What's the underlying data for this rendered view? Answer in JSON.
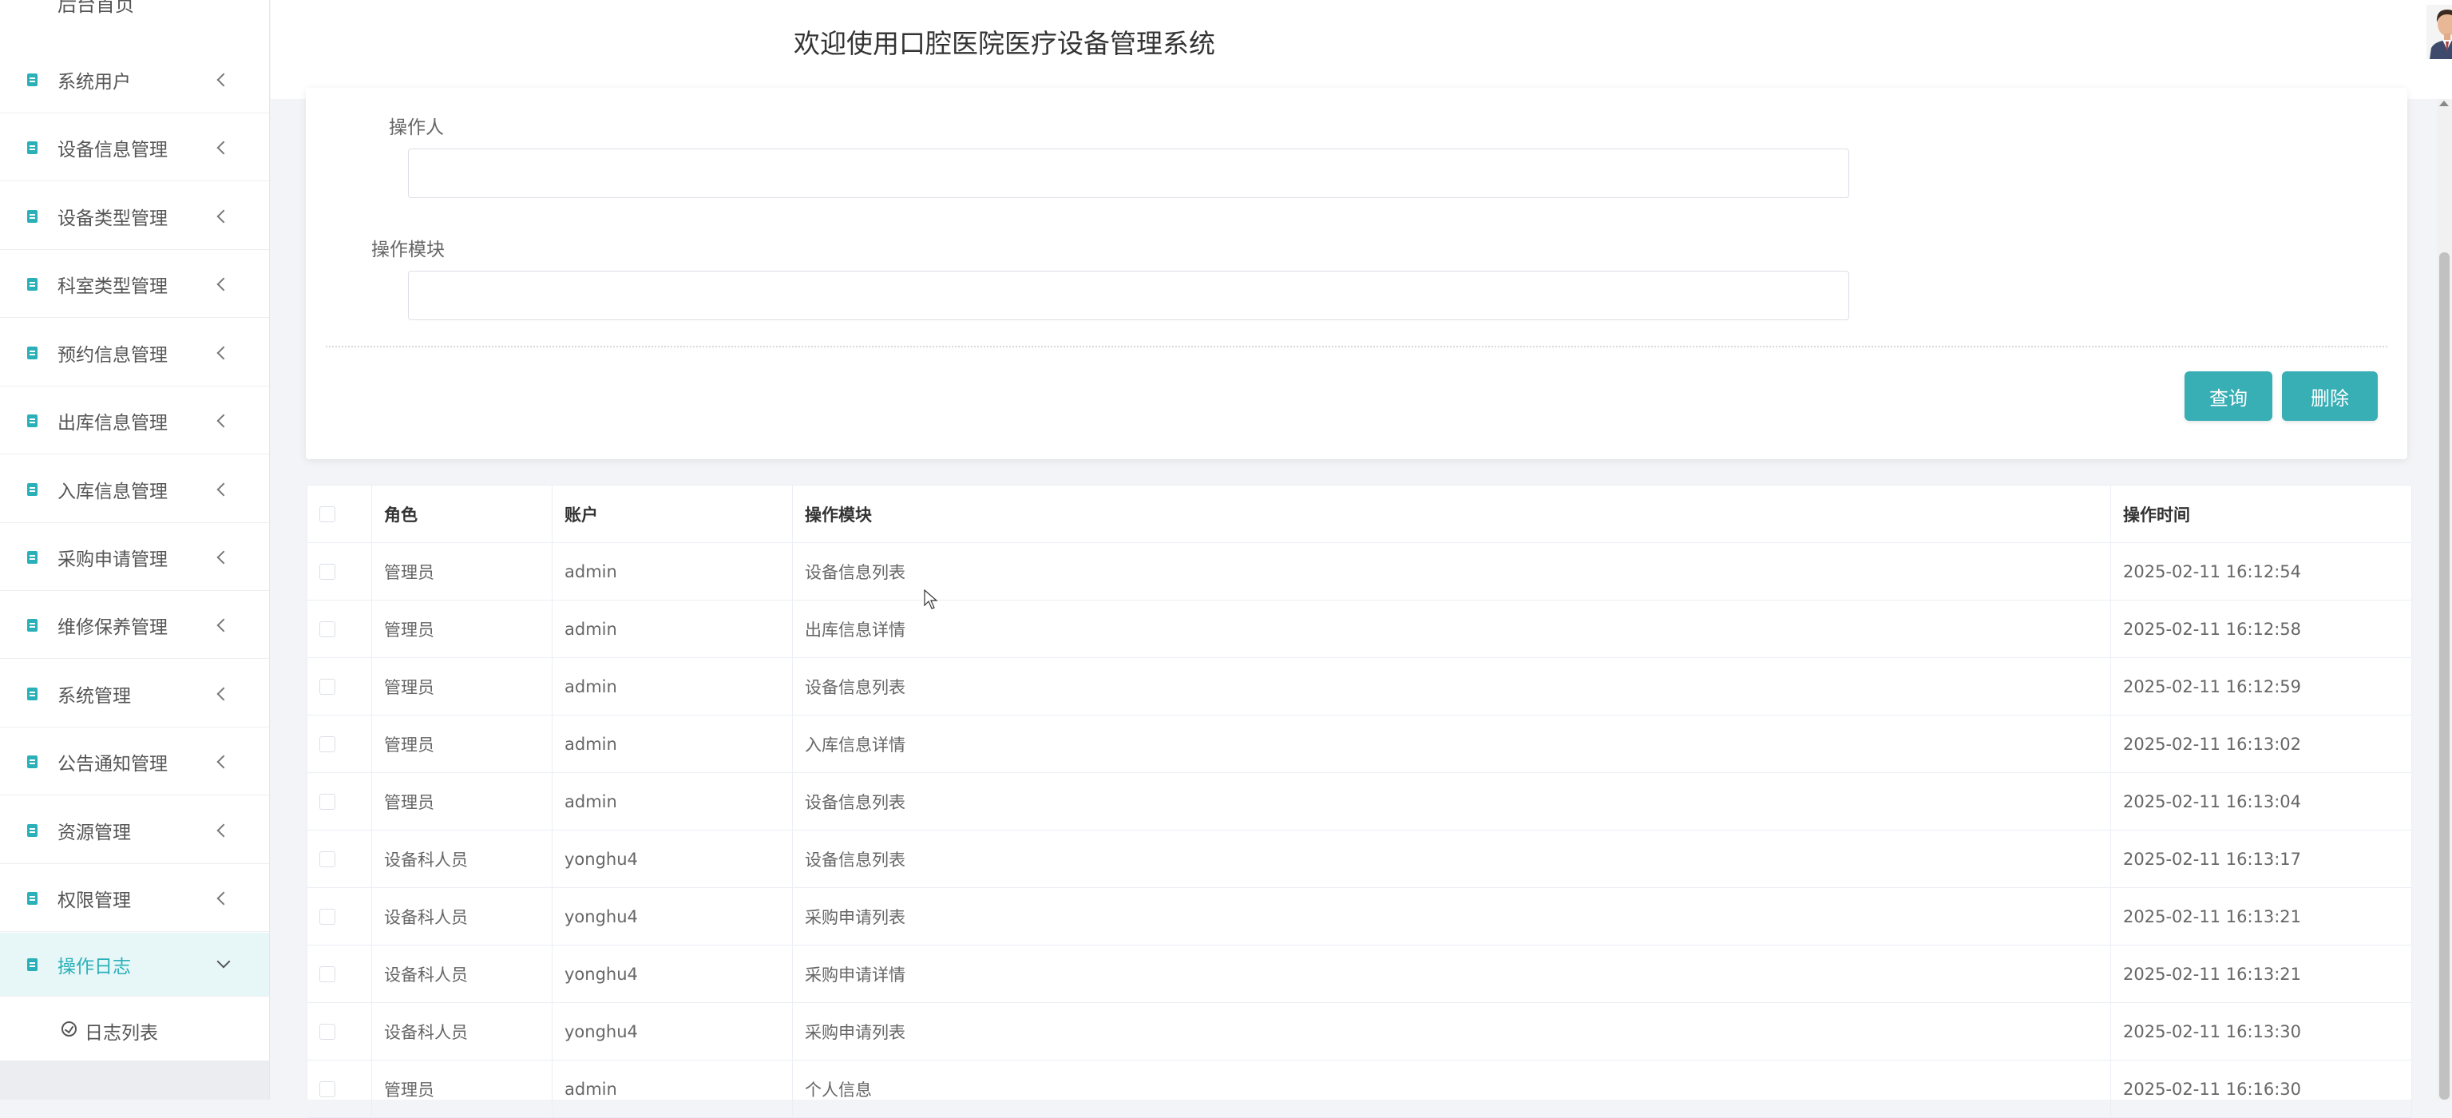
{
  "sidebar": {
    "partial_label": "后台首页",
    "items": [
      {
        "label": "系统用户"
      },
      {
        "label": "设备信息管理"
      },
      {
        "label": "设备类型管理"
      },
      {
        "label": "科室类型管理"
      },
      {
        "label": "预约信息管理"
      },
      {
        "label": "出库信息管理"
      },
      {
        "label": "入库信息管理"
      },
      {
        "label": "采购申请管理"
      },
      {
        "label": "维修保养管理"
      },
      {
        "label": "系统管理"
      },
      {
        "label": "公告通知管理"
      },
      {
        "label": "资源管理"
      },
      {
        "label": "权限管理"
      },
      {
        "label": "操作日志"
      }
    ],
    "active_item": "操作日志",
    "submenu": {
      "label": "日志列表"
    }
  },
  "header": {
    "title": "欢迎使用口腔医院医疗设备管理系统"
  },
  "search": {
    "operator_label": "操作人",
    "operator_value": "",
    "module_label": "操作模块",
    "module_value": "",
    "query_button": "查询",
    "delete_button": "删除"
  },
  "table": {
    "columns": [
      "角色",
      "账户",
      "操作模块",
      "操作时间"
    ],
    "rows": [
      {
        "role": "管理员",
        "account": "admin",
        "module": "设备信息列表",
        "time": "2025-02-11 16:12:54"
      },
      {
        "role": "管理员",
        "account": "admin",
        "module": "出库信息详情",
        "time": "2025-02-11 16:12:58"
      },
      {
        "role": "管理员",
        "account": "admin",
        "module": "设备信息列表",
        "time": "2025-02-11 16:12:59"
      },
      {
        "role": "管理员",
        "account": "admin",
        "module": "入库信息详情",
        "time": "2025-02-11 16:13:02"
      },
      {
        "role": "管理员",
        "account": "admin",
        "module": "设备信息列表",
        "time": "2025-02-11 16:13:04"
      },
      {
        "role": "设备科人员",
        "account": "yonghu4",
        "module": "设备信息列表",
        "time": "2025-02-11 16:13:17"
      },
      {
        "role": "设备科人员",
        "account": "yonghu4",
        "module": "采购申请列表",
        "time": "2025-02-11 16:13:21"
      },
      {
        "role": "设备科人员",
        "account": "yonghu4",
        "module": "采购申请详情",
        "time": "2025-02-11 16:13:21"
      },
      {
        "role": "设备科人员",
        "account": "yonghu4",
        "module": "采购申请列表",
        "time": "2025-02-11 16:13:30"
      },
      {
        "role": "管理员",
        "account": "admin",
        "module": "个人信息",
        "time": "2025-02-11 16:16:30"
      }
    ]
  },
  "colors": {
    "accent": "#38aeb5",
    "active_bg": "#e7f7f8",
    "icon": "#2ab0b8"
  },
  "icons": {
    "menu": "document-icon",
    "submenu": "clock-icon",
    "collapse": "chevron-left-icon",
    "expand": "chevron-down-icon"
  }
}
